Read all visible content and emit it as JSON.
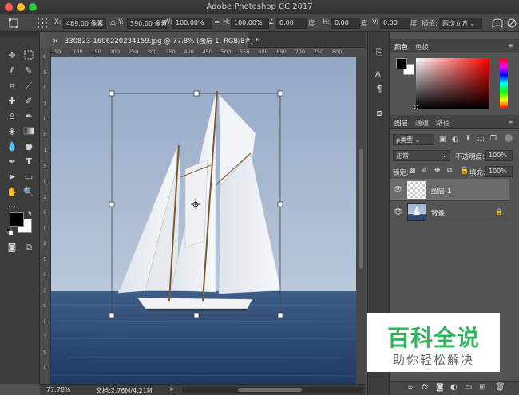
{
  "window": {
    "title": "Adobe Photoshop CC 2017",
    "controls": {
      "close_color": "#fc5f57",
      "min_color": "#fdbc2e",
      "max_color": "#28c840"
    }
  },
  "options": {
    "x_label": "X:",
    "x_value": "489.00 像素",
    "y_label": "Y:",
    "y_value": "390.00 像素",
    "w_label": "W:",
    "w_value": "100.00%",
    "h_label": "H:",
    "h_value": "100.00%",
    "angle_value": "0.00",
    "angle_unit": "度",
    "hskew_label": "H:",
    "hskew_value": "0.00",
    "hskew_unit": "度",
    "vskew_label": "V:",
    "vskew_value": "0.00",
    "vskew_unit": "度",
    "interp_label": "插值:",
    "interp_value": "两次立方"
  },
  "document": {
    "tab_title": "330823-16062202​34159.jpg @ 77.8% (图层 1, RGB/8#) *",
    "tab_close": "×"
  },
  "rulers": {
    "top": [
      "50",
      "100",
      "150",
      "200",
      "250",
      "300",
      "350",
      "400",
      "450",
      "500",
      "550",
      "600",
      "650",
      "700",
      "750",
      "800"
    ],
    "left": [
      "0",
      "5",
      "0",
      "1",
      "0",
      "0",
      "1",
      "5",
      "0",
      "2",
      "0",
      "0",
      "2",
      "5",
      "0",
      "3",
      "0",
      "0",
      "3",
      "5",
      "0"
    ]
  },
  "status": {
    "zoom": "77.78%",
    "doc_size": "文档:2.76M/4.21M",
    "arrow": ">"
  },
  "color_panel": {
    "tabs": [
      "颜色",
      "色板"
    ],
    "foreground": "#000000",
    "background": "#ffffff",
    "hue": "#ff0000"
  },
  "layers_panel": {
    "tabs": [
      "图层",
      "通道",
      "路径"
    ],
    "filter_label": "ρ类型",
    "blend_mode": "正常",
    "opacity_label": "不透明度:",
    "opacity_value": "100%",
    "lock_label": "锁定:",
    "fill_label": "填充:",
    "fill_value": "100%",
    "layers": [
      {
        "name": "图层 1",
        "visible": true,
        "selected": true
      },
      {
        "name": "背景",
        "visible": true,
        "selected": false,
        "locked": true
      }
    ],
    "footer_icons": [
      "link-icon",
      "fx-icon",
      "mask-icon",
      "adjustment-icon",
      "group-icon",
      "new-layer-icon",
      "trash-icon"
    ]
  },
  "watermark": {
    "title": "百科全说",
    "subtitle": "助你轻松解决"
  },
  "tools": [
    "move-tool-icon",
    "marquee-tool-icon",
    "lasso-tool-icon",
    "quick-select-icon",
    "crop-tool-icon",
    "eyedropper-icon",
    "healing-brush-icon",
    "brush-tool-icon",
    "clone-stamp-icon",
    "history-brush-icon",
    "eraser-tool-icon",
    "gradient-tool-icon",
    "blur-tool-icon",
    "dodge-tool-icon",
    "pen-tool-icon",
    "type-tool-icon",
    "path-select-icon",
    "rectangle-tool-icon",
    "hand-tool-icon",
    "zoom-tool-icon"
  ]
}
